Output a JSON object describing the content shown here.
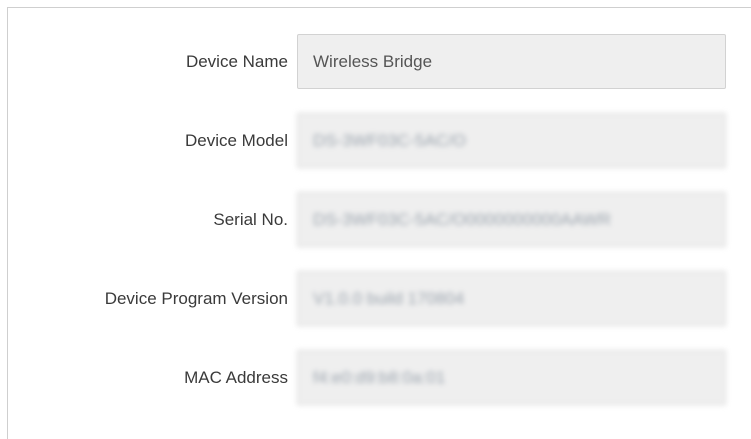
{
  "form": {
    "fields": [
      {
        "label": "Device Name",
        "value": "Wireless Bridge"
      },
      {
        "label": "Device Model",
        "value": "DS-3WF03C-5AC/O"
      },
      {
        "label": "Serial No.",
        "value": "DS-3WF03C-5AC/O0000000000AAWR"
      },
      {
        "label": "Device Program Version",
        "value": "V1.0.0 build 170804"
      },
      {
        "label": "MAC Address",
        "value": "f4:e0:d9:b8:0a:01"
      }
    ]
  }
}
